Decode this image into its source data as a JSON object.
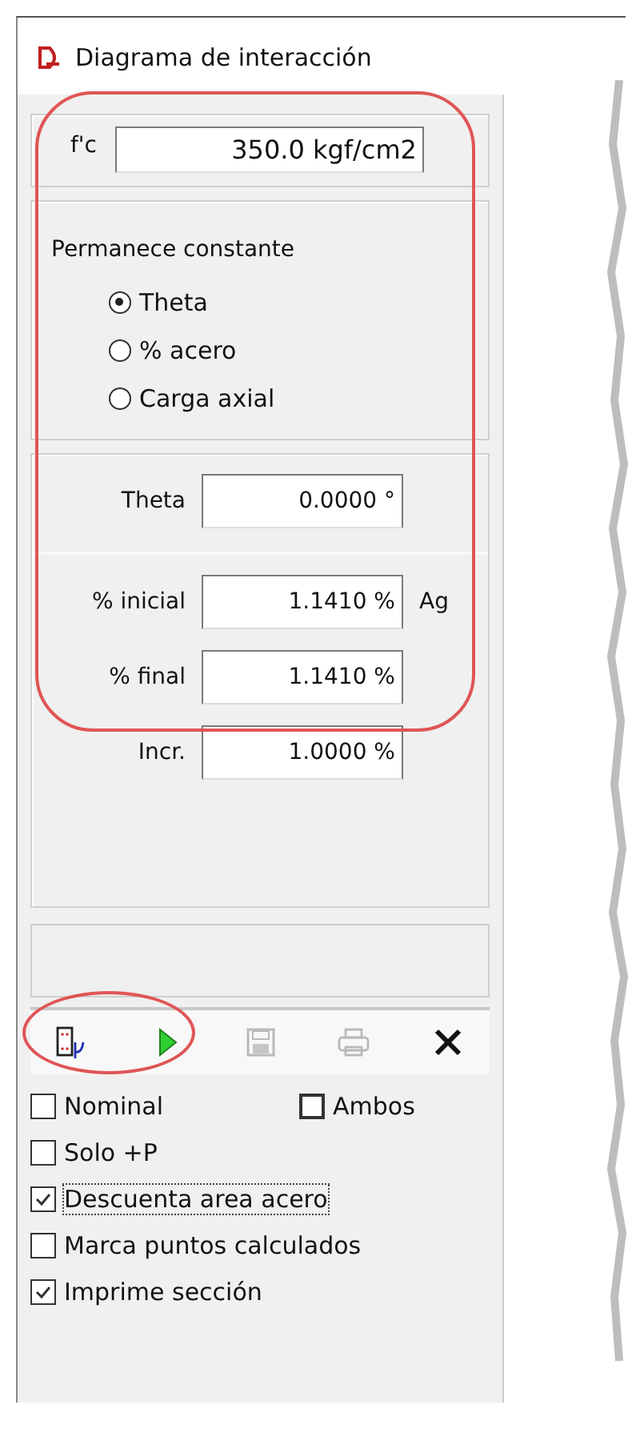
{
  "window": {
    "title": "Diagrama de interacción"
  },
  "fc": {
    "label": "f'c",
    "value": "350.0 kgf/cm2"
  },
  "constant_group": {
    "title": "Permanece constante",
    "options": [
      {
        "label": "Theta",
        "selected": true
      },
      {
        "label": "% acero",
        "selected": false
      },
      {
        "label": "Carga axial",
        "selected": false
      }
    ]
  },
  "theta": {
    "label": "Theta",
    "value": "0.0000 °"
  },
  "range": [
    {
      "label": "% inicial",
      "value": "1.1410 %",
      "unit": "Ag"
    },
    {
      "label": "% final",
      "value": "1.1410 %"
    },
    {
      "label": "Incr.",
      "value": "1.0000 %"
    }
  ],
  "toolbar": [
    {
      "kind": "section",
      "disabled": false
    },
    {
      "kind": "run",
      "disabled": false
    },
    {
      "kind": "save",
      "disabled": true
    },
    {
      "kind": "print",
      "disabled": true
    },
    {
      "kind": "close",
      "disabled": false
    }
  ],
  "options": [
    {
      "label": "Nominal",
      "checked": false,
      "focused": false
    },
    {
      "label": "Ambos",
      "checked": false,
      "focused": false
    },
    {
      "label": "Solo +P",
      "checked": false,
      "focused": false
    },
    {
      "label": "Descuenta area acero",
      "checked": true,
      "focused": true
    },
    {
      "label": "Marca puntos calculados",
      "checked": false,
      "focused": false
    },
    {
      "label": "Imprime sección",
      "checked": true,
      "focused": false
    }
  ]
}
